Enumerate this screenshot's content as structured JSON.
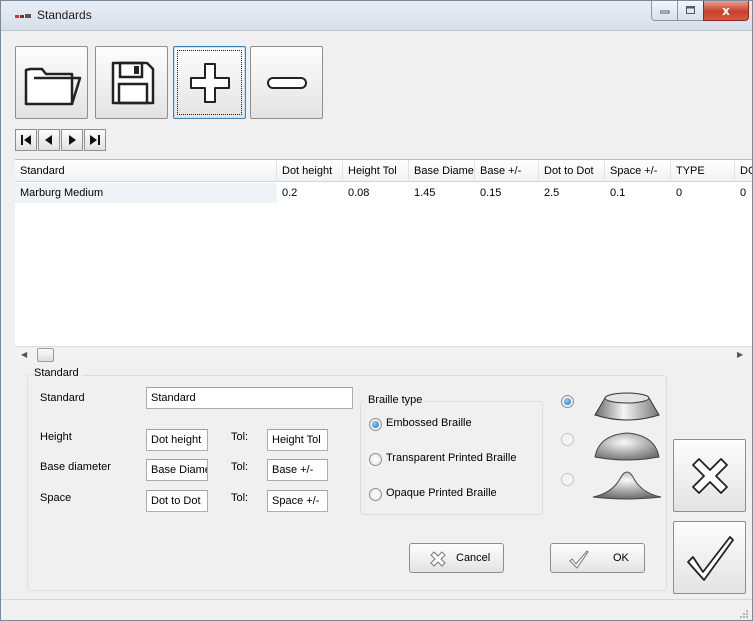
{
  "window": {
    "title": "Standards",
    "controls": [
      "minimize-icon",
      "maximize-icon",
      "close-icon"
    ]
  },
  "toolbar": {
    "buttons": [
      "open-folder-icon",
      "save-disk-icon",
      "add-plus-icon",
      "remove-minus-icon"
    ]
  },
  "navigator": {
    "buttons": [
      "first-record-icon",
      "prior-record-icon",
      "next-record-icon",
      "last-record-icon"
    ]
  },
  "grid": {
    "columns": [
      "Standard",
      "Dot height",
      "Height Tol",
      "Base Diamete",
      "Base +/-",
      "Dot to Dot",
      "Space +/-",
      "TYPE",
      "DC"
    ],
    "rows": [
      [
        "Marburg Medium",
        "0.2",
        "0.08",
        "1.45",
        "0.15",
        "2.5",
        "0.1",
        "0",
        "0"
      ]
    ]
  },
  "form": {
    "group_title": "Standard",
    "standard_label": "Standard",
    "standard_value": "Standard",
    "height_label": "Height",
    "height_value": "Dot height",
    "height_tol_label": "Tol:",
    "height_tol_value": "Height Tol",
    "base_label": "Base diameter",
    "base_value": "Base Diame",
    "base_tol_label": "Tol:",
    "base_tol_value": "Base +/-",
    "space_label": "Space",
    "space_value": "Dot to Dot",
    "space_tol_label": "Tol:",
    "space_tol_value": "Space +/-"
  },
  "braille_type": {
    "title": "Braille type",
    "options": [
      {
        "label": "Embossed Braille",
        "selected": true
      },
      {
        "label": "Transparent Printed Braille",
        "selected": false
      },
      {
        "label": "Opaque Printed Braille",
        "selected": false
      }
    ]
  },
  "dot_shapes": {
    "options": [
      {
        "shape": "truncated-cone-icon",
        "selected": true
      },
      {
        "shape": "dome-icon",
        "selected": false
      },
      {
        "shape": "bell-icon",
        "selected": false
      }
    ]
  },
  "actions": {
    "cancel_label": "Cancel",
    "ok_label": "OK"
  },
  "colors": {
    "window_bg": "#f0f0f0",
    "close_button": "#c7402b",
    "selected_radio": "#1f6fb8",
    "focus_border": "#3c7fb1"
  }
}
